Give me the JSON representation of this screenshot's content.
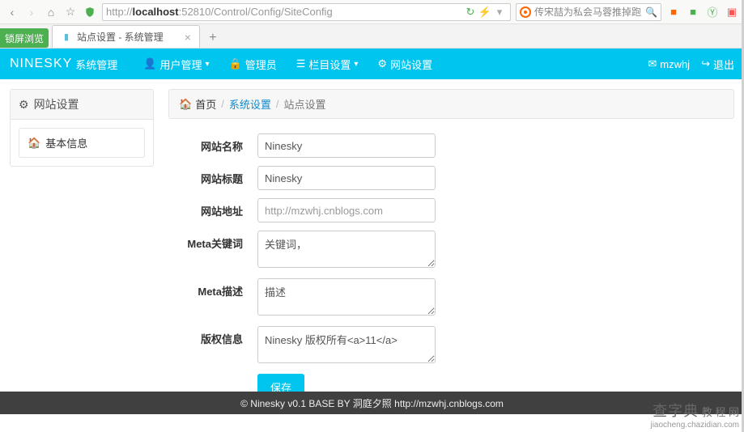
{
  "browser": {
    "url_prefix": "http://",
    "url_bold": "localhost",
    "url_rest": ":52810/Control/Config/SiteConfig",
    "search_placeholder": "传宋喆为私会马蓉推掉跑男",
    "side_tag": "锁屏浏览",
    "tab_title": "站点设置 - 系统管理"
  },
  "nav": {
    "brand": "NINESKY",
    "brand_sub": "系统管理",
    "items": [
      {
        "label": "用户管理",
        "caret": true
      },
      {
        "label": "管理员",
        "caret": false
      },
      {
        "label": "栏目设置",
        "caret": true
      },
      {
        "label": "网站设置",
        "caret": false
      }
    ],
    "user": "mzwhj",
    "logout": "退出"
  },
  "sidebar": {
    "title": "网站设置",
    "link": "基本信息"
  },
  "breadcrumb": {
    "home": "首页",
    "lvl1": "系统设置",
    "lvl2": "站点设置"
  },
  "form": {
    "rows": [
      {
        "label": "网站名称",
        "type": "input",
        "value": "Ninesky"
      },
      {
        "label": "网站标题",
        "type": "input",
        "value": "Ninesky"
      },
      {
        "label": "网站地址",
        "type": "input-ro",
        "value": "http://mzwhj.cnblogs.com"
      },
      {
        "label": "Meta关键词",
        "type": "textarea",
        "value": "关键词，"
      },
      {
        "label": "Meta描述",
        "type": "textarea",
        "value": "描述"
      },
      {
        "label": "版权信息",
        "type": "textarea",
        "value": "Ninesky 版权所有<a>11</a>"
      }
    ],
    "save": "保存"
  },
  "footer": "© Ninesky v0.1 BASE BY 洞庭夕照 http://mzwhj.cnblogs.com",
  "watermark": {
    "line1": "查字典",
    "line1b": "教 程 网",
    "line2": "jiaocheng.chazidian.com"
  }
}
